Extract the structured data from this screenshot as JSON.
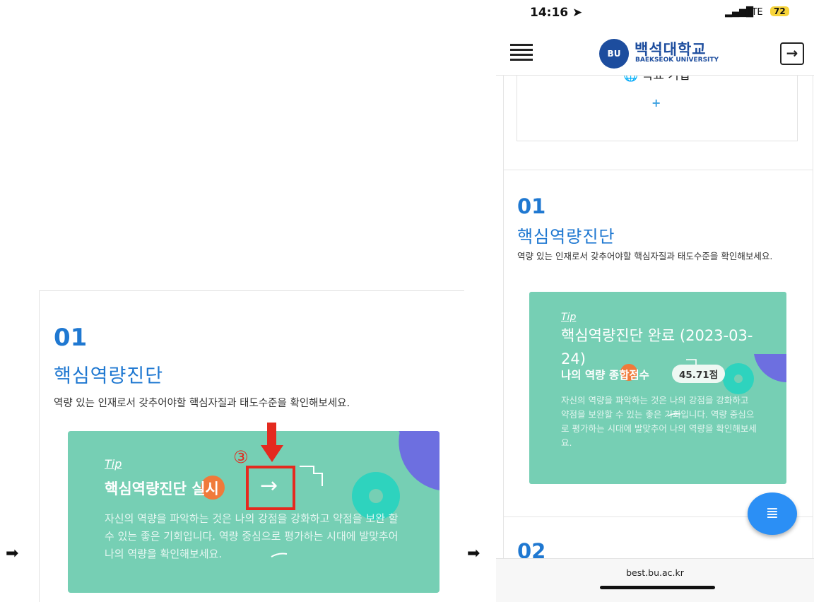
{
  "left": {
    "number": "01",
    "title": "핵심역량진단",
    "description": "역량 있는 인재로서 갖추어야할 핵심자질과 태도수준을 확인해보세요.",
    "card": {
      "tip": "Tip",
      "title": "핵심역량진단 실시",
      "arrow": "→",
      "body": "자신의 역량을 파악하는 것은 나의 강점을 강화하고 약점을 보완 할 수 있는 좋은 기회입니다. 역량 중심으로 평가하는 시대에 발맞추어 나의 역량을 확인해보세요."
    },
    "step_marker": "③",
    "pointer": "➡"
  },
  "phone": {
    "status": {
      "time": "14:16 ➤",
      "signal": "▂▄▆█",
      "network": "LTE",
      "battery": "72"
    },
    "header": {
      "logo_emblem": "BU",
      "logo_korean": "백석대학교",
      "logo_english": "BAEKSEOK UNIVERSITY",
      "menu_icon": "menu-icon",
      "logout_icon": "logout-icon"
    },
    "previous_section": {
      "label": "🌐 목표 기입",
      "plus": "+"
    },
    "section": {
      "number": "01",
      "title": "핵심역량진단",
      "description": "역량 있는 인재로서 갖추어야할 핵심자질과 태도수준을 확인해보세요.",
      "card": {
        "tip": "Tip",
        "title": "핵심역량진단 완료 (2023-03-24)",
        "score_label": "나의 역량 종합점수",
        "score": "45.71점",
        "body": "자신의 역량을 파악하는 것은 나의 강점을 강화하고 약점을 보완할 수 있는 좋은 기회입니다. 역량 중심으로 평가하는 시대에 발맞추어 나의 역량을 확인해보세요."
      }
    },
    "next_section_number": "02",
    "fab_icon": "≣",
    "url": "best.bu.ac.kr"
  },
  "colors": {
    "accent_blue": "#1f78d1",
    "card_green": "#76cfb4",
    "marker_red": "#e42a1f",
    "fab_blue": "#2b8ff5"
  }
}
